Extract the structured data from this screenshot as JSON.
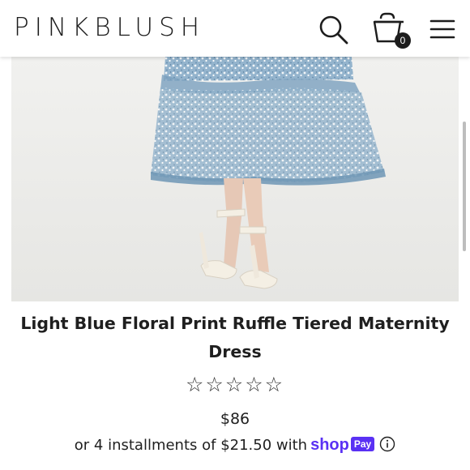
{
  "header": {
    "brand": "PINKBLUSH",
    "cart_count": "0",
    "icons": [
      "search-icon",
      "shopping-bag-icon",
      "hamburger-menu-icon"
    ]
  },
  "product": {
    "image_alt": "Light blue floral print ruffle tiered maternity dress with white heeled sandals",
    "title": "Light Blue Floral Print Ruffle Tiered Maternity Dress",
    "rating_stars": "☆☆☆☆☆",
    "rating_value": 0,
    "price": "$86",
    "installments_text": "or 4 installments of $21.50 with",
    "shop_word": "shop",
    "pay_badge": "Pay",
    "info_icon": "info-icon"
  },
  "colors": {
    "shop_pay_purple": "#5a31f4",
    "text": "#1f1f1f",
    "dress_blue": "#86a9c4"
  }
}
